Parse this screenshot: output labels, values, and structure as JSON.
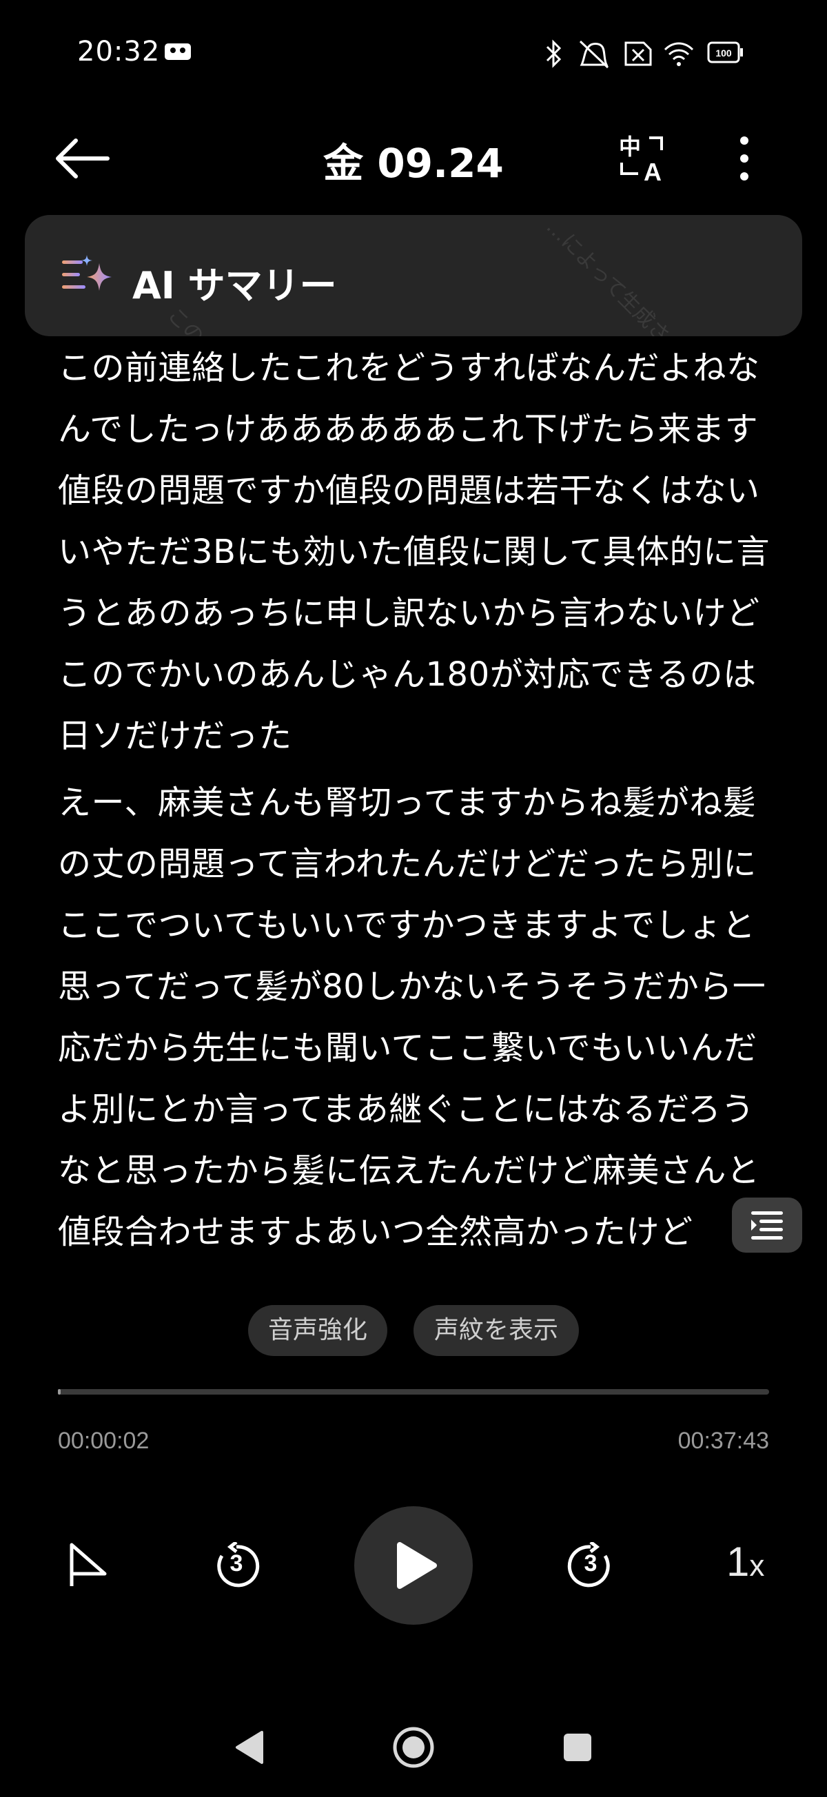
{
  "status_bar": {
    "time": "20:32",
    "icons": [
      "screen-record-icon",
      "bluetooth-icon",
      "vibrate-off-icon",
      "no-sim-icon",
      "wifi-icon",
      "battery-icon"
    ],
    "battery_text": "100"
  },
  "header": {
    "title": "金 09.24",
    "icons": [
      "back-arrow-icon",
      "translate-icon",
      "more-vert-icon"
    ]
  },
  "ai_summary": {
    "label": "AI サマリー",
    "watermark_text_1": "この…れています。",
    "watermark_text_2": "…によって生成さ…",
    "icon": "ai-sparkle-icon"
  },
  "transcript": {
    "paragraphs": [
      "この前連絡したこれをどうすればなんだよねなんでしたっけああああああこれ下げたら来ます値段の問題ですか値段の問題は若干なくはないいやただ3Bにも効いた値段に関して具体的に言うとあのあっちに申し訳ないから言わないけどこのでかいのあんじゃん180が対応できるのは日ソだけだった",
      "えー、麻美さんも腎切ってますからね髪がね髪の丈の問題って言われたんだけどだったら別にここでついてもいいですかつきますよでしょと思ってだって髪が80しかないそうそうだから一応だから先生にも聞いてここ繋いでもいいんだよ別にとか言ってまあ継ぐことにはなるだろうなと思ったから髪に伝えたんだけど麻美さんと値段合わせますよあいつ全然高かったけど"
    ]
  },
  "chips": {
    "enhance_voice": "音声強化",
    "show_voiceprint": "声紋を表示"
  },
  "player": {
    "current_time": "00:00:02",
    "total_time": "00:37:43",
    "progress": 0.001,
    "rewind_seconds": "3",
    "forward_seconds": "3",
    "speed_value": "1",
    "speed_suffix": "x"
  },
  "nav": {
    "icons": [
      "nav-back-icon",
      "nav-home-icon",
      "nav-recents-icon"
    ]
  }
}
